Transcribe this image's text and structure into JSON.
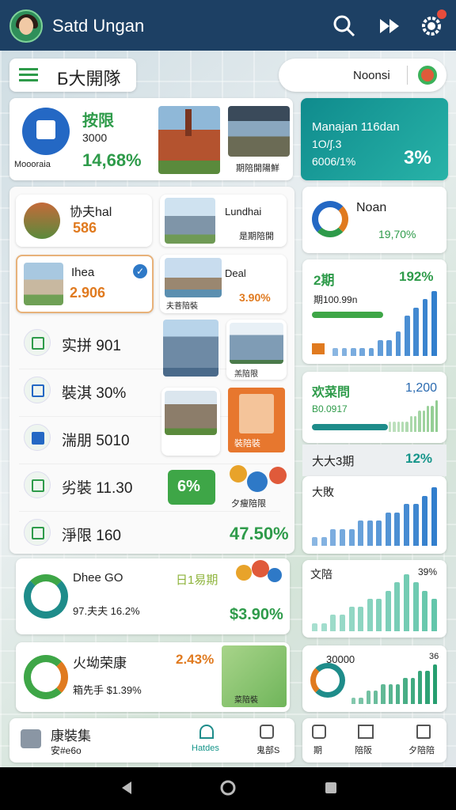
{
  "header": {
    "title": "Satd Ungan",
    "icons": [
      "search-icon",
      "play-icon",
      "settings-icon"
    ]
  },
  "subbar": {
    "menu_label": "Б大開隊",
    "right_label": "Noonsi"
  },
  "card_a": {
    "title": "按限",
    "sub": "3000",
    "caption": "Moooraia",
    "value": "14,68%",
    "photo2_caption": "期陪開陽鮮"
  },
  "card_b": {
    "line1": "Manajan 116dan",
    "line2": "1O/ʃ.3",
    "line3": "6006/1%",
    "value": "3%"
  },
  "card_c": {
    "title": "协夫hal",
    "value": "586"
  },
  "card_d": {
    "title": "Lundhai",
    "sub": "是期陪開"
  },
  "card_e": {
    "title": "Noan",
    "value": "19,70%"
  },
  "card_f": {
    "title": "Ihea",
    "value": "2.906",
    "check": "✓"
  },
  "card_g": {
    "title": "Deal",
    "sub": "夫菩陪裝",
    "value": "3.90%"
  },
  "card_h": {
    "title": "2期",
    "value": "192%",
    "sub": "期100.99n"
  },
  "rows": [
    {
      "label": "实拼 901"
    },
    {
      "label": "裝淇 30%"
    },
    {
      "label": "湍朋 5010"
    },
    {
      "label": "劣裝 11.30"
    },
    {
      "label": "淨限 160"
    }
  ],
  "card_mid": {
    "badge": "6%",
    "sub": "夕瘦陪限",
    "city_caption": "羔陪限",
    "orange_caption": "裝陪裝"
  },
  "row5_value": "47.50%",
  "card_i": {
    "title": "欢菜問",
    "value": "1,200",
    "sub": "B0.0917"
  },
  "card_j": {
    "title": "大大3期",
    "value": "12%"
  },
  "card_k": {
    "title": "大敗"
  },
  "card_l": {
    "title": "Dhee GO",
    "mid": "日1易期",
    "sub": "97.夫夫 16.2%",
    "value": "$3.90%"
  },
  "card_m": {
    "title": "文陪",
    "value": "39%"
  },
  "card_n": {
    "title": "火坳荣康",
    "value": "2.43%",
    "sub": "箱先手 $1.39%",
    "map_caption": "菜陪裝"
  },
  "card_o": {
    "title": "30000",
    "value": "36"
  },
  "bottom": {
    "item1_title": "康裝集",
    "item1_sub": "安#e6o",
    "tab1": "Hatdes",
    "tab2": "鬼部S",
    "tab3": "期",
    "tab4": "陪阪",
    "tab5": "夕陪陪"
  },
  "chart_data": [
    {
      "type": "bar",
      "title": "2期",
      "values": [
        1,
        1,
        1,
        1,
        1,
        2,
        2,
        3,
        5,
        6,
        7,
        8
      ]
    },
    {
      "type": "bar",
      "title": "欢菜問",
      "values": [
        2,
        2,
        2,
        2,
        2,
        3,
        3,
        4,
        4,
        5,
        5,
        6
      ]
    },
    {
      "type": "bar",
      "title": "大敗",
      "values": [
        1,
        1,
        2,
        2,
        2,
        3,
        3,
        3,
        4,
        4,
        5,
        5,
        6,
        7
      ]
    },
    {
      "type": "bar",
      "title": "文陪",
      "values": [
        1,
        1,
        2,
        2,
        3,
        3,
        4,
        4,
        5,
        6,
        7,
        6,
        5,
        4
      ]
    },
    {
      "type": "bar",
      "title": "30000",
      "values": [
        1,
        1,
        2,
        2,
        3,
        3,
        3,
        4,
        4,
        5,
        5,
        6
      ]
    }
  ]
}
